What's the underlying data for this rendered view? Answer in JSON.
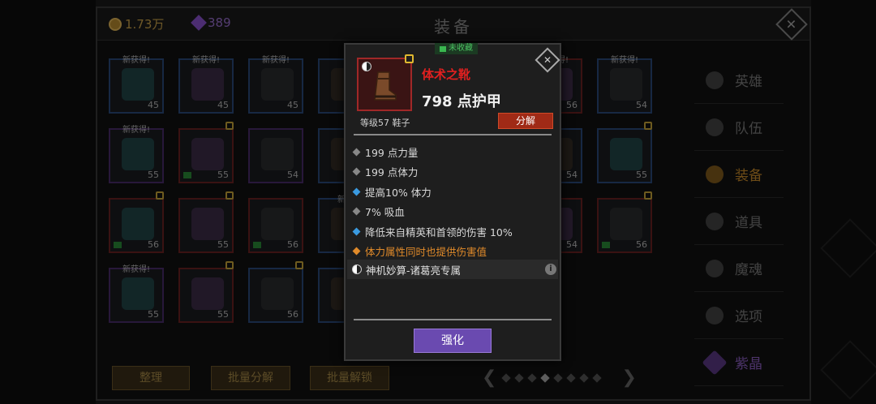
{
  "currency": {
    "gold": "1.73万",
    "gems": "389"
  },
  "title": "装备",
  "slots": [
    {
      "new": "新获得!",
      "level": "45",
      "quality": "blue"
    },
    {
      "new": "新获得!",
      "level": "45",
      "quality": "blue"
    },
    {
      "new": "新获得!",
      "level": "45",
      "quality": "blue"
    },
    {
      "new": "",
      "level": "",
      "quality": "blue"
    },
    {
      "new": "新获得!",
      "level": "55",
      "quality": "purple"
    },
    {
      "new": "",
      "level": "55",
      "quality": "red",
      "lock": true,
      "book": true
    },
    {
      "new": "",
      "level": "54",
      "quality": "purple"
    },
    {
      "new": "",
      "level": "",
      "quality": "blue"
    },
    {
      "new": "",
      "level": "56",
      "quality": "red",
      "lock": true,
      "book": true
    },
    {
      "new": "",
      "level": "55",
      "quality": "red",
      "lock": true
    },
    {
      "new": "",
      "level": "56",
      "quality": "red",
      "book": true
    },
    {
      "new": "新获",
      "level": "",
      "quality": "blue"
    },
    {
      "new": "新获得!",
      "level": "55",
      "quality": "purple"
    },
    {
      "new": "",
      "level": "55",
      "quality": "red",
      "lock": true
    },
    {
      "new": "",
      "level": "56",
      "quality": "blue",
      "lock": true
    },
    {
      "new": "",
      "level": "",
      "quality": "blue"
    }
  ],
  "slots_right": [
    {
      "new": "新获得!",
      "level": "56",
      "quality": "red"
    },
    {
      "new": "新获得!",
      "level": "54",
      "quality": "blue"
    },
    {
      "new": "",
      "level": "54",
      "quality": "blue"
    },
    {
      "new": "",
      "level": "55",
      "quality": "blue",
      "lock": true
    },
    {
      "new": "",
      "level": "54",
      "quality": "red"
    },
    {
      "new": "",
      "level": "56",
      "quality": "red",
      "lock": true,
      "book": true
    }
  ],
  "sidebar": [
    {
      "label": "英雄"
    },
    {
      "label": "队伍"
    },
    {
      "label": "装备",
      "active": true
    },
    {
      "label": "道具"
    },
    {
      "label": "魔魂"
    },
    {
      "label": "选项"
    },
    {
      "label": "紫晶",
      "crystal": true
    }
  ],
  "bottom": {
    "sort": "整理",
    "batch_salvage": "批量分解",
    "batch_unlock": "批量解锁"
  },
  "pager": {
    "pages": 8,
    "current": 4
  },
  "item": {
    "collect_tag": "未收藏",
    "name": "体术之靴",
    "armor": "798 点护甲",
    "level_type": "等级57 鞋子",
    "salvage": "分解",
    "stats": [
      {
        "text": "199 点力量",
        "kind": "gray"
      },
      {
        "text": "199 点体力",
        "kind": "gray"
      },
      {
        "text": "提高10% 体力",
        "kind": "blue"
      },
      {
        "text": "7% 吸血",
        "kind": "gray"
      },
      {
        "text": "降低来自精英和首领的伤害 10%",
        "kind": "blue"
      },
      {
        "text": "体力属性同时也提供伤害值",
        "kind": "orange"
      }
    ],
    "set_name": "神机妙算-诸葛亮专属",
    "enhance": "强化"
  },
  "colors": {
    "accent": "#c98a2a",
    "legendary": "#e22020",
    "enhance": "#6a4ab0"
  }
}
